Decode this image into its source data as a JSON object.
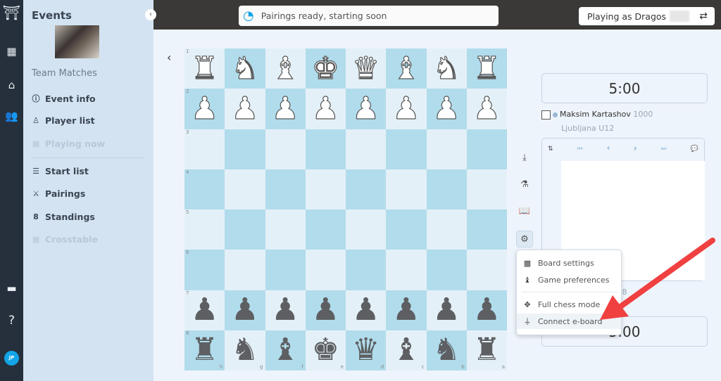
{
  "rail": {
    "icons": [
      "logo-icon",
      "calendar-icon",
      "arena-icon",
      "users-icon",
      "window-icon",
      "help-icon"
    ],
    "help": "?",
    "avatar": "JP"
  },
  "sidebar": {
    "title": "Events",
    "event_name": "Team Matches",
    "items": [
      {
        "label": "Event info",
        "icon": "ⓘ",
        "disabled": false
      },
      {
        "label": "Player list",
        "icon": "♙",
        "disabled": false
      },
      {
        "label": "Playing now",
        "icon": "▦",
        "disabled": true
      },
      {
        "label": "Start list",
        "icon": "☰",
        "disabled": false
      },
      {
        "label": "Pairings",
        "icon": "⚔",
        "disabled": false
      },
      {
        "label": "Standings",
        "icon": "8",
        "disabled": false
      },
      {
        "label": "Crosstable",
        "icon": "▦",
        "disabled": true
      }
    ]
  },
  "topbar": {
    "status": "Pairings ready, starting soon",
    "playing_as": "Playing as Dragos"
  },
  "board": {
    "ranks": [
      "1",
      "2",
      "3",
      "4",
      "5",
      "6",
      "7",
      "8"
    ],
    "files": [
      "h",
      "g",
      "f",
      "e",
      "d",
      "c",
      "b",
      "a"
    ],
    "rows": [
      [
        "wR",
        "wN",
        "wB",
        "wK",
        "wQ",
        "wB",
        "wN",
        "wR"
      ],
      [
        "wP",
        "wP",
        "wP",
        "wP",
        "wP",
        "wP",
        "wP",
        "wP"
      ],
      [
        "",
        "",
        "",
        "",
        "",
        "",
        "",
        ""
      ],
      [
        "",
        "",
        "",
        "",
        "",
        "",
        "",
        ""
      ],
      [
        "",
        "",
        "",
        "",
        "",
        "",
        "",
        ""
      ],
      [
        "",
        "",
        "",
        "",
        "",
        "",
        "",
        ""
      ],
      [
        "bP",
        "bP",
        "bP",
        "bP",
        "bP",
        "bP",
        "bP",
        "bP"
      ],
      [
        "bR",
        "bN",
        "bB",
        "bK",
        "bQ",
        "bB",
        "bN",
        "bR"
      ]
    ],
    "light_color": "#e4f0f7",
    "dark_color": "#b1dcec"
  },
  "game": {
    "top_clock": "5:00",
    "bottom_clock": "5:00",
    "player": {
      "name": "Maksim Kartashov",
      "rating": "1000",
      "club": "Ljubljana U12"
    },
    "player2_fragment": "u 18"
  },
  "menu": {
    "items": [
      "Board settings",
      "Game preferences",
      "Full chess mode",
      "Connect e-board"
    ],
    "highlighted": "Connect e-board"
  },
  "annotation": {
    "arrow_color": "#f04040"
  }
}
